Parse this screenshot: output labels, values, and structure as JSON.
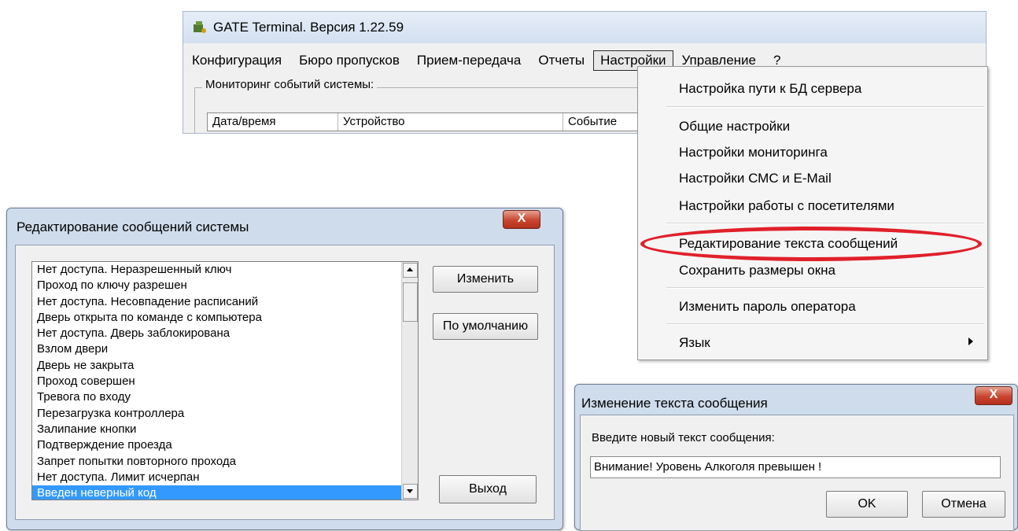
{
  "main_window": {
    "title": "GATE Terminal.  Версия 1.22.59",
    "menu": [
      {
        "label": "Конфигурация"
      },
      {
        "label": "Бюро пропусков"
      },
      {
        "label": "Прием-передача"
      },
      {
        "label": "Отчеты"
      },
      {
        "label": "Настройки"
      },
      {
        "label": "Управление"
      },
      {
        "label": "?"
      }
    ],
    "monitor_group_label": "Мониторинг событий системы:",
    "columns": [
      "Дата/время",
      "Устройство",
      "Событие"
    ]
  },
  "settings_menu": {
    "items": [
      "Настройка пути к БД сервера",
      "Общие настройки",
      "Настройки мониторинга",
      "Настройки СМС и E-Mail",
      "Настройки работы с посетителями",
      "Редактирование текста сообщений",
      "Сохранить размеры окна",
      "Изменить пароль оператора",
      "Язык"
    ]
  },
  "edit_dialog": {
    "title": "Редактирование сообщений системы",
    "close_label": "X",
    "messages": [
      "Нет доступа. Неразрешенный ключ",
      "Проход по ключу разрешен",
      "Нет доступа. Несовпадение расписаний",
      "Дверь открыта по команде с компьютера",
      "Нет доступа. Дверь заблокирована",
      "Взлом двери",
      "Дверь не закрыта",
      "Проход совершен",
      "Тревога по входу",
      "Перезагрузка контроллера",
      "Залипание кнопки",
      "Подтверждение проезда",
      "Запрет попытки повторного прохода",
      "Нет доступа. Лимит исчерпан",
      "Введен неверный код"
    ],
    "selected_index": 14,
    "buttons": {
      "change": "Изменить",
      "default": "По умолчанию",
      "exit": "Выход"
    }
  },
  "change_dialog": {
    "title": "Изменение текста сообщения",
    "close_label": "X",
    "prompt": "Введите новый текст сообщения:",
    "input_value": "Внимание! Уровень Алкоголя превышен !",
    "buttons": {
      "ok": "OK",
      "cancel": "Отмена"
    }
  },
  "colors": {
    "selection": "#3399ff",
    "highlight_ellipse": "#e0202a",
    "dialog_frame": "#cfdcec"
  }
}
